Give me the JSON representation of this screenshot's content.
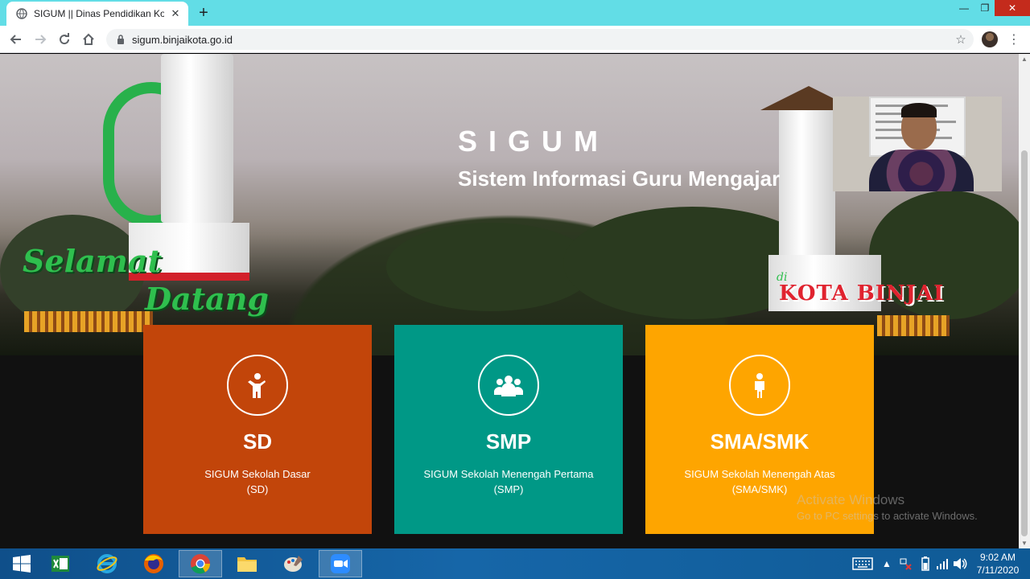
{
  "browser": {
    "tab_title": "SIGUM || Dinas Pendidikan Kota B",
    "new_tab_label": "+",
    "url": "sigum.binjaikota.go.id",
    "window_controls": {
      "minimize": "—",
      "maximize": "❐",
      "close": "✕"
    }
  },
  "hero": {
    "brand": "SIGUM",
    "tagline": "Sistem Informasi Guru Mengajar",
    "welcome_1": "Selamat",
    "welcome_2": "Datang",
    "di": "di",
    "city": "KOTA BINJAI"
  },
  "cards": [
    {
      "title": "SD",
      "desc_1": "SIGUM Sekolah Dasar",
      "desc_2": "(SD)",
      "color": "#c2450a",
      "icon": "child-icon"
    },
    {
      "title": "SMP",
      "desc_1": "SIGUM Sekolah Menengah Pertama",
      "desc_2": "(SMP)",
      "color": "#009886",
      "icon": "group-icon"
    },
    {
      "title": "SMA/SMK",
      "desc_1": "SIGUM Sekolah Menengah Atas",
      "desc_2": "(SMA/SMK)",
      "color": "#fea500",
      "icon": "person-icon"
    }
  ],
  "watermark": {
    "line1": "Activate Windows",
    "line2": "Go to PC settings to activate Windows."
  },
  "taskbar": {
    "time": "9:02 AM",
    "date": "7/11/2020",
    "apps": [
      "windows-start-icon",
      "excel-icon",
      "internet-explorer-icon",
      "firefox-icon",
      "chrome-icon",
      "file-explorer-icon",
      "paint-icon",
      "zoom-icon"
    ]
  }
}
